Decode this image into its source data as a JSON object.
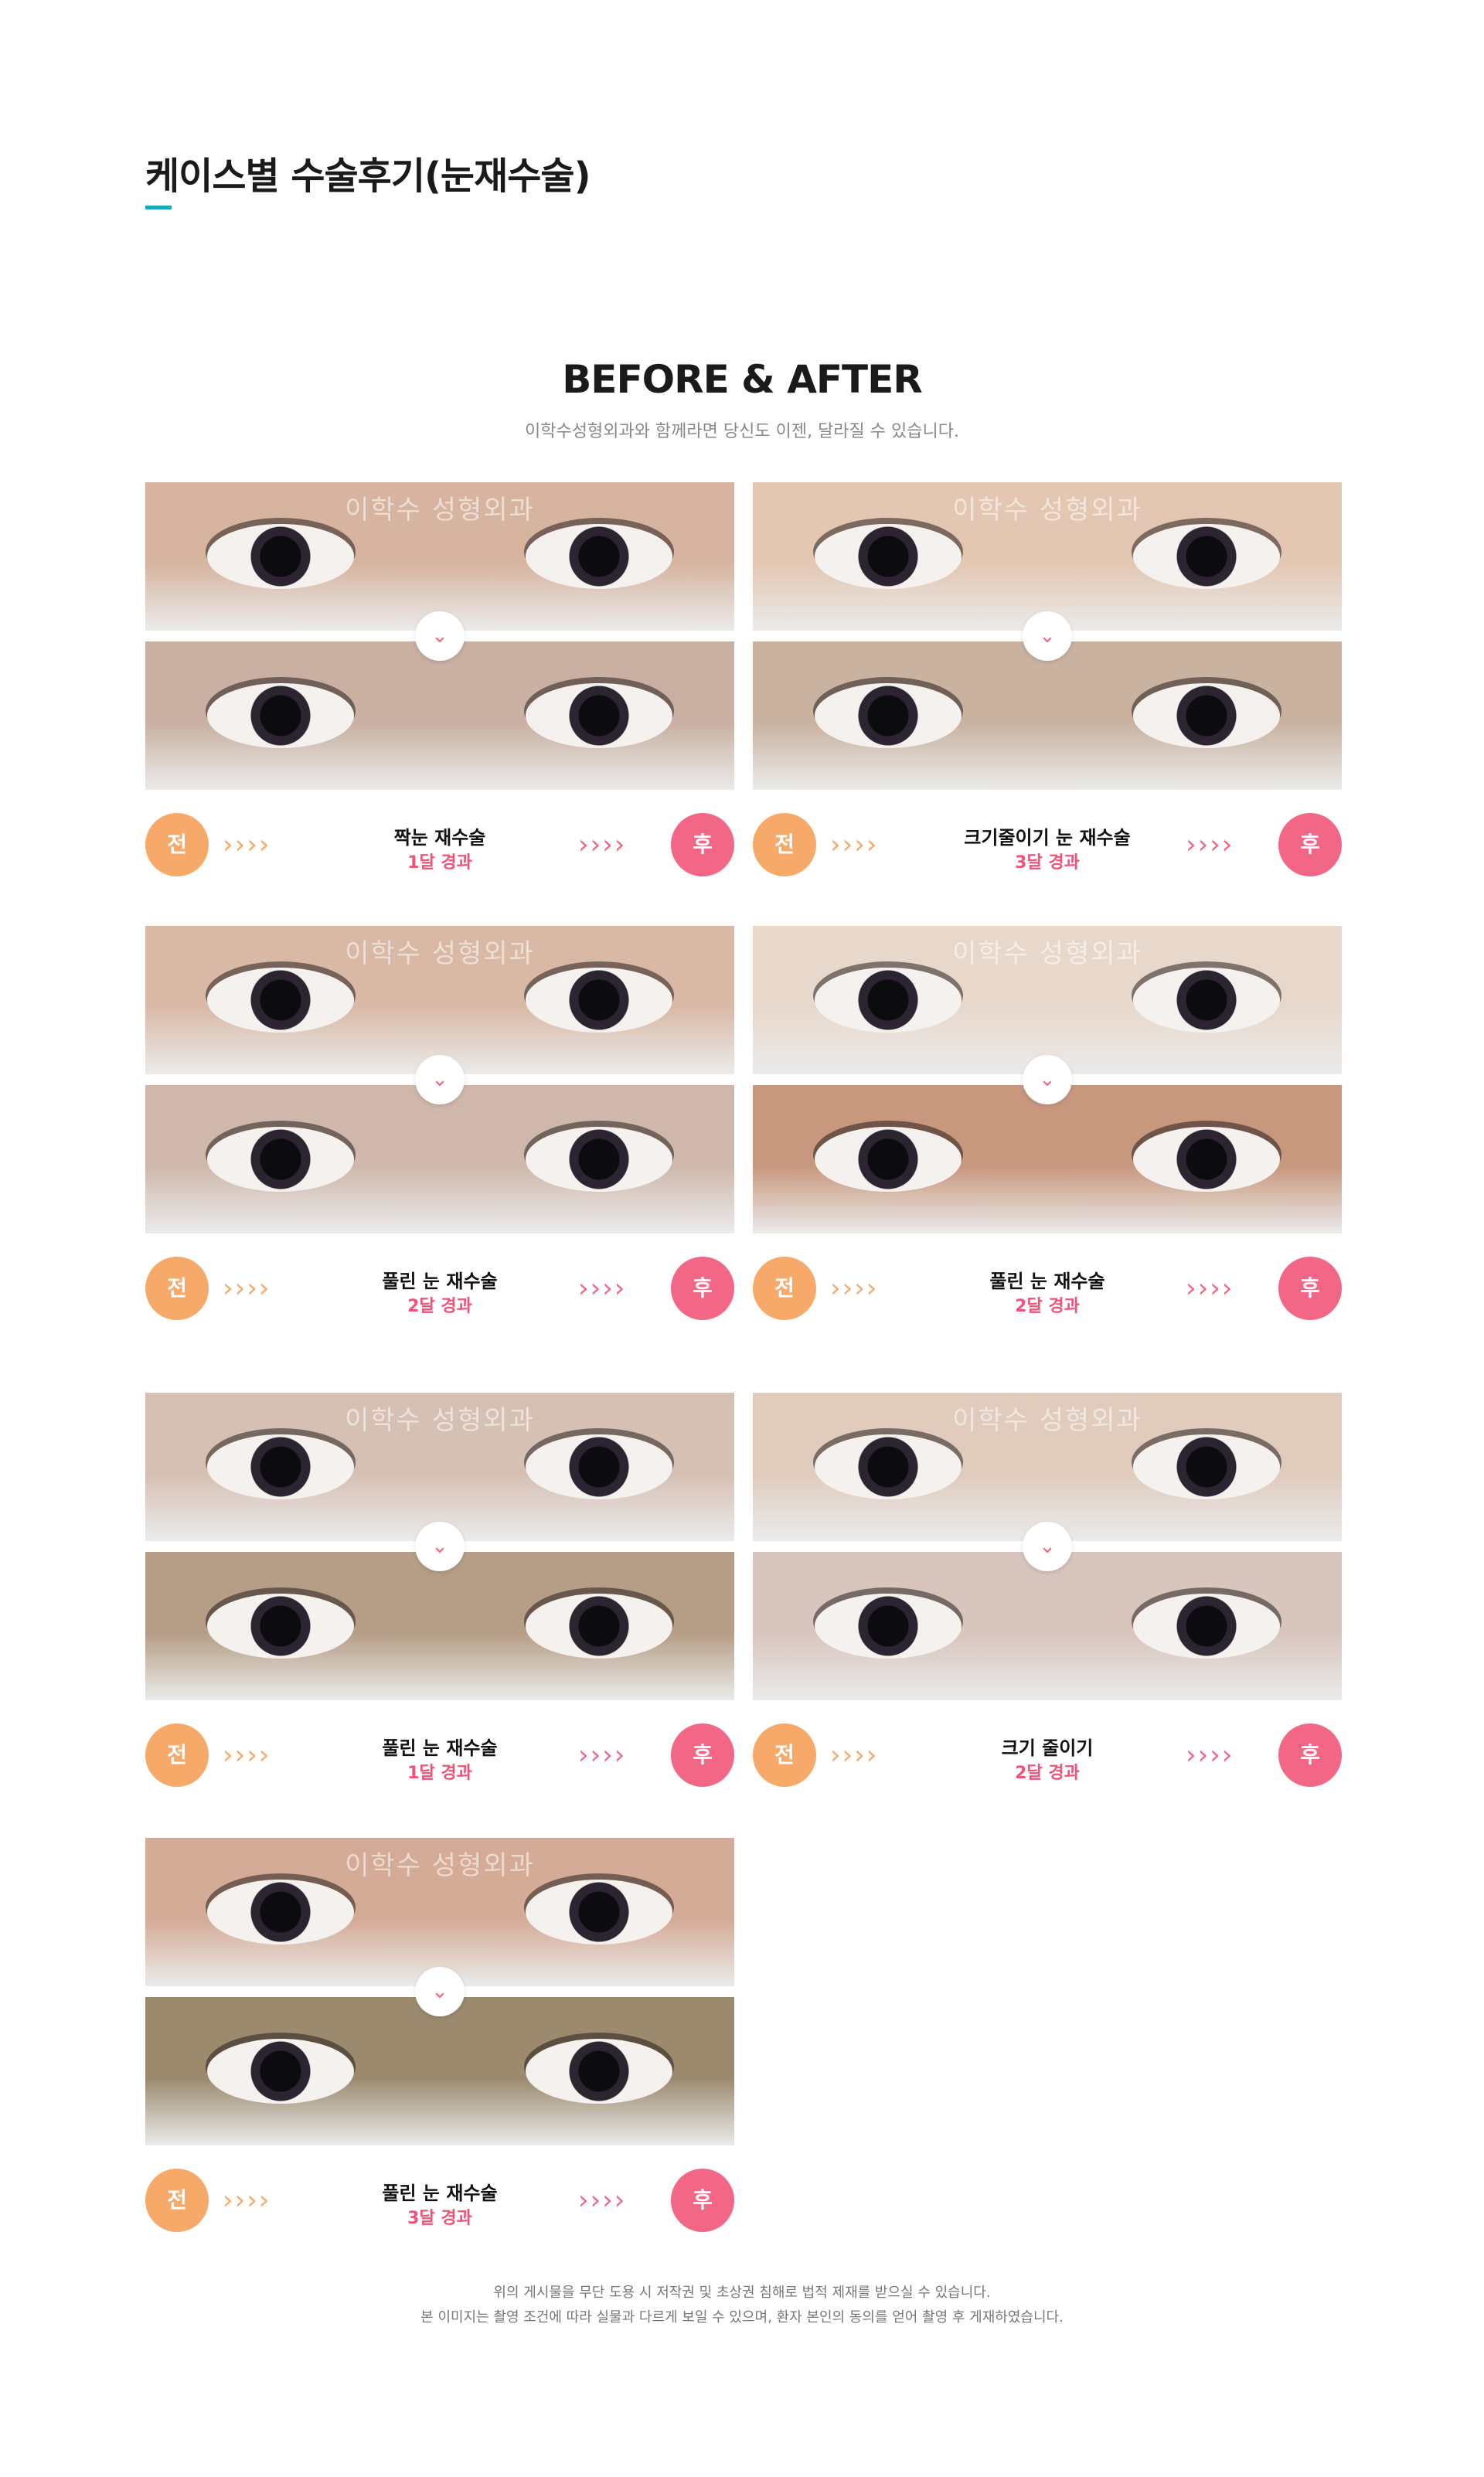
{
  "page": {
    "title": "케이스별 수술후기(눈재수술)",
    "heading": "BEFORE & AFTER",
    "subtitle": "이학수성형외과와 함께라면 당신도 이젠, 달라질 수 있습니다."
  },
  "labels": {
    "before": "전",
    "after": "후",
    "watermark": "이학수 성형외과",
    "arrows_left": "››››",
    "arrows_right": "››››",
    "divider_icon": "⌄"
  },
  "colors": {
    "accent_line": "#16a9c0",
    "before_badge": "#f7a96a",
    "after_badge": "#f26785",
    "period_text": "#f0527a"
  },
  "icons": [
    "chevron-down-icon",
    "arrow-right-icon"
  ],
  "cases": [
    {
      "title": "짝눈 재수술",
      "period": "1달 경과",
      "before_tone": "#d7b4a0",
      "after_tone": "#c9b0a2"
    },
    {
      "title": "크기줄이기 눈 재수술",
      "period": "3달 경과",
      "before_tone": "#e3c7b2",
      "after_tone": "#c9b2a0"
    },
    {
      "title": "풀린 눈 재수술",
      "period": "2달 경과",
      "before_tone": "#d9b9a5",
      "after_tone": "#cfb8ab"
    },
    {
      "title": "풀린 눈 재수술",
      "period": "2달 경과",
      "before_tone": "#e8d8cc",
      "after_tone": "#c8987e"
    },
    {
      "title": "풀린 눈 재수술",
      "period": "1달 경과",
      "before_tone": "#d6c0b4",
      "after_tone": "#b69e86"
    },
    {
      "title": "크기 줄이기",
      "period": "2달 경과",
      "before_tone": "#e0cbbd",
      "after_tone": "#d8c5bd"
    },
    {
      "title": "풀린 눈 재수술",
      "period": "3달 경과",
      "before_tone": "#d4ab96",
      "after_tone": "#9c8a6e"
    }
  ],
  "footer": {
    "line1": "위의 게시물을 무단 도용 시 저작권 및 초상권 침해로 법적 제재를 받으실 수 있습니다.",
    "line2": "본 이미지는 촬영 조건에 따라 실물과 다르게 보일 수 있으며, 환자 본인의 동의를 얻어 촬영 후 게재하였습니다."
  }
}
